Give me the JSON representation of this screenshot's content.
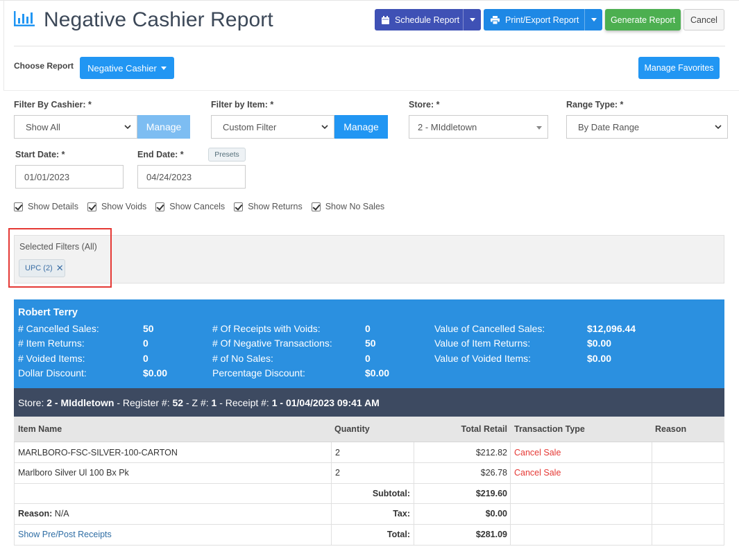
{
  "header": {
    "title": "Negative Cashier Report",
    "schedule_label": "Schedule Report",
    "print_label": "Print/Export Report",
    "generate_label": "Generate Report",
    "cancel_label": "Cancel"
  },
  "choose": {
    "label": "Choose Report",
    "report_value": "Negative Cashier",
    "favorites_label": "Manage Favorites"
  },
  "filters": {
    "cashier_label": "Filter By Cashier: *",
    "cashier_value": "Show All",
    "cashier_manage": "Manage",
    "item_label": "Filter by Item: *",
    "item_value": "Custom Filter",
    "item_manage": "Manage",
    "store_label": "Store: *",
    "store_value": "2 - MIddletown",
    "range_label": "Range Type: *",
    "range_value": "By Date Range",
    "start_label": "Start Date: *",
    "start_value": "01/01/2023",
    "end_label": "End Date: *",
    "end_value": "04/24/2023",
    "presets_label": "Presets"
  },
  "checkboxes": [
    {
      "label": "Show Details",
      "checked": true
    },
    {
      "label": "Show Voids",
      "checked": true
    },
    {
      "label": "Show Cancels",
      "checked": true
    },
    {
      "label": "Show Returns",
      "checked": true
    },
    {
      "label": "Show No Sales",
      "checked": true
    }
  ],
  "selected_filters": {
    "title": "Selected Filters (All)",
    "chip": "UPC (2)"
  },
  "summary": {
    "cashier_name": "Robert Terry",
    "col1": [
      {
        "label": "# Cancelled Sales:",
        "value": "50"
      },
      {
        "label": "# Item Returns:",
        "value": "0"
      },
      {
        "label": "# Voided Items:",
        "value": "0"
      },
      {
        "label": "Dollar Discount:",
        "value": "$0.00"
      }
    ],
    "col2": [
      {
        "label": "# Of Receipts with Voids:",
        "value": "0"
      },
      {
        "label": "# Of Negative Transactions:",
        "value": "50"
      },
      {
        "label": "# of No Sales:",
        "value": "0"
      },
      {
        "label": "Percentage Discount:",
        "value": "$0.00"
      }
    ],
    "col3": [
      {
        "label": "Value of Cancelled Sales:",
        "value": "$12,096.44"
      },
      {
        "label": "Value of Item Returns:",
        "value": "$0.00"
      },
      {
        "label": "Value of Voided Items:",
        "value": "$0.00"
      }
    ]
  },
  "receipt": {
    "store_prefix": "Store: ",
    "store": "2 - MIddletown",
    "register_prefix": " - Register #: ",
    "register": "52",
    "z_prefix": " - Z #: ",
    "z": "1",
    "receipt_prefix": " - Receipt #: ",
    "receipt": "1",
    "datetime": " - 01/04/2023 09:41 AM"
  },
  "table": {
    "headers": [
      "Item Name",
      "Quantity",
      "Total Retail",
      "Transaction Type",
      "Reason"
    ],
    "rows": [
      {
        "item": "MARLBORO-FSC-SILVER-100-CARTON",
        "qty": "2",
        "retail": "$212.82",
        "type": "Cancel Sale",
        "reason": ""
      },
      {
        "item": "Marlboro Silver Ul 100 Bx Pk",
        "qty": "2",
        "retail": "$26.78",
        "type": "Cancel Sale",
        "reason": ""
      }
    ],
    "subtotal_label": "Subtotal:",
    "subtotal_value": "$219.60",
    "reason_label": "Reason:",
    "reason_value": " N/A",
    "tax_label": "Tax:",
    "tax_value": "$0.00",
    "prepost_link": "Show Pre/Post Receipts",
    "total_label": "Total:",
    "total_value": "$281.09"
  },
  "colors": {
    "schedule": "#3f51b5",
    "print": "#1e88e5",
    "generate": "#4caf50",
    "primary": "#2196f3",
    "summary_bg": "#2b90e0",
    "store_bar": "#3d4a61",
    "highlight": "#e53935"
  }
}
